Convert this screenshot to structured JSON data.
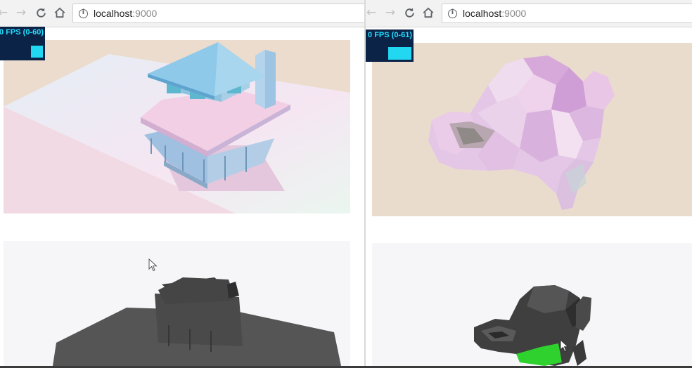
{
  "left_window": {
    "toolbar": {
      "back_icon": "back-arrow-icon",
      "forward_icon": "forward-arrow-icon",
      "reload_icon": "reload-icon",
      "home_icon": "home-icon",
      "url_host": "localhost",
      "url_port": ":9000"
    },
    "stats": {
      "label": "0 FPS (0-60)"
    },
    "top_canvas": {
      "scene": "house-rendered"
    },
    "bottom_canvas": {
      "scene": "house-shadow"
    }
  },
  "right_window": {
    "toolbar": {
      "back_icon": "back-arrow-icon",
      "forward_icon": "forward-arrow-icon",
      "reload_icon": "reload-icon",
      "home_icon": "home-icon",
      "url_host": "localhost",
      "url_port": ":9000"
    },
    "stats": {
      "label": "0 FPS (0-61)"
    },
    "top_canvas": {
      "scene": "sculpture-rendered"
    },
    "bottom_canvas": {
      "scene": "sculpture-shadow"
    }
  },
  "colors": {
    "fps_background": "#0b2347",
    "fps_accent": "#23e0ff",
    "canvas_background": "#e9ddd0",
    "highlight_green": "#2fd12f"
  }
}
